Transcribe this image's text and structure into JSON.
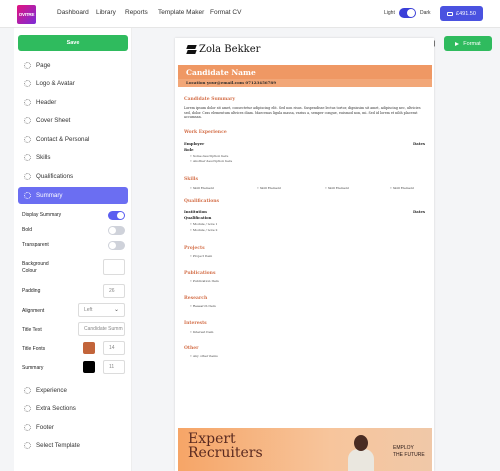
{
  "app": {
    "logo_text": "OVITRE",
    "nav": [
      "Dashboard",
      "Library",
      "Reports",
      "Template Maker",
      "Format CV"
    ],
    "theme_light": "Light",
    "theme_dark": "Dark",
    "price": "£491.50"
  },
  "sidebar": {
    "save_label": "Save",
    "items_top": [
      "Page",
      "Logo & Avatar",
      "Header",
      "Cover Sheet",
      "Contact & Personal",
      "Skills",
      "Qualifications",
      "Summary"
    ],
    "summary_options": {
      "display_summary": "Display Summary",
      "bold": "Bold",
      "transparent": "Transparent",
      "background_colour": "Background Colour",
      "padding": "Padding",
      "padding_value": "26",
      "alignment": "Alignment",
      "alignment_value": "Left",
      "title_text": "Title Text",
      "title_text_placeholder": "Candidate Summ",
      "title_fonts": "Title Fonts",
      "title_fonts_size": "14",
      "summary": "Summary",
      "summary_size": "11",
      "title_font_color": "#c2643a",
      "summary_color": "#000000"
    },
    "items_bottom": [
      "Experience",
      "Extra Sections",
      "Footer",
      "Select Template"
    ]
  },
  "toolbar": {
    "save_icon": "floppy-icon",
    "format_label": "Format"
  },
  "cv": {
    "brand": "Zola Bekker",
    "candidate_name": "Candidate Name",
    "contact": "Location   your@email.com   07123456789",
    "summary_title": "Candidate Summary",
    "summary_text": "Lorem ipsum dolor sit amet, consectetur adipiscing elit. Sed non risus. Suspendisse lectus tortor, dignissim sit amet, adipiscing nec, ultricies sed, dolor. Cras elementum ultrices diam. Maecenas ligula massa, varius a, semper congue, euismod non, mi. Sed id lorem et nibh placerat accumsan.",
    "work_title": "Work Experience",
    "employer": "Employer",
    "role": "Role",
    "dates": "Dates",
    "work_items": [
      "Some description here",
      "Another description here"
    ],
    "skills_title": "Skills",
    "skills": [
      "Skill Element",
      "Skill Element",
      "Skill Element",
      "Skill Element"
    ],
    "qual_title": "Qualifications",
    "institution": "Institution",
    "qualification": "Qualification",
    "qual_dates": "Dates",
    "modules": [
      "Module / note 1",
      "Module / note 2"
    ],
    "projects_title": "Projects",
    "projects_item": "Project Item",
    "publications_title": "Publications",
    "publications_item": "Publication Item",
    "research_title": "Research",
    "research_item": "Research Item",
    "interests_title": "Interests",
    "interests_item": "Interest Item",
    "other_title": "Other",
    "other_item": "Any other items"
  },
  "ad": {
    "line1": "Expert",
    "line2": "Recruiters",
    "sub1": "EMPLOY",
    "sub2": "THE FUTURE"
  },
  "colors": {
    "accent": "#4a52e0",
    "save_green": "#2fbb5e",
    "cv_orange": "#ef9864",
    "section_title": "#d4704a"
  }
}
